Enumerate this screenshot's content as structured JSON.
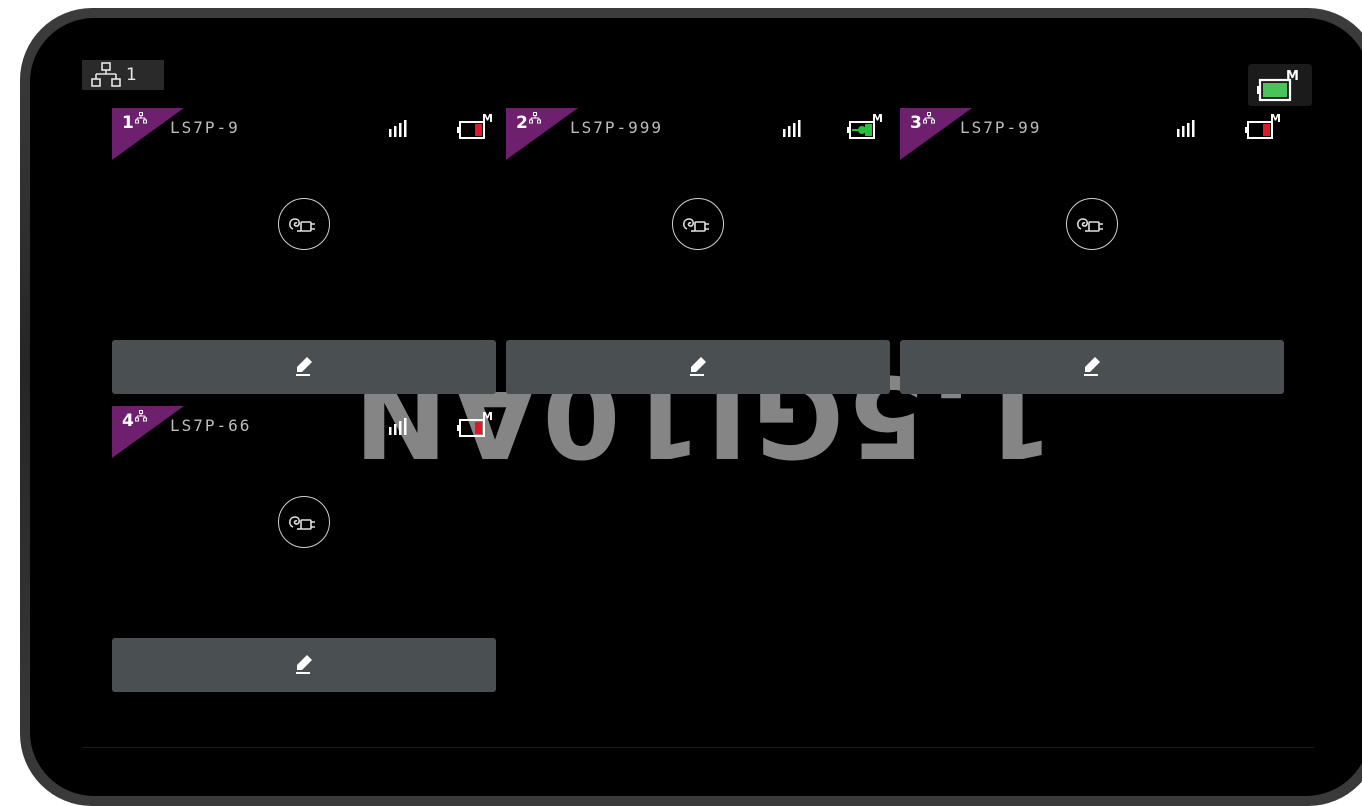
{
  "header": {
    "group_number": "1",
    "corner_dots": "..",
    "top_battery_mode": "M",
    "top_battery_color": "#4cc25a"
  },
  "watermark": {
    "text": "1.5GI10AN"
  },
  "cards": [
    {
      "index": "1",
      "name": "LS7P-9",
      "battery_mode": "M",
      "battery_color": "#e0192a",
      "plug_icon": "plug-icon",
      "edit_icon": "pencil-icon"
    },
    {
      "index": "2",
      "name": "LS7P-999",
      "battery_mode": "M",
      "battery_color": "#22c23a",
      "plug_icon": "plug-icon",
      "edit_icon": "pencil-icon"
    },
    {
      "index": "3",
      "name": "LS7P-99",
      "battery_mode": "M",
      "battery_color": "#e0192a",
      "plug_icon": "plug-icon",
      "edit_icon": "pencil-icon"
    },
    {
      "index": "4",
      "name": "LS7P-66",
      "battery_mode": "M",
      "battery_color": "#e0192a",
      "plug_icon": "plug-icon",
      "edit_icon": "pencil-icon"
    }
  ],
  "colors": {
    "accent_purple": "#6e1f6e",
    "edit_bar": "#4a4f51",
    "screen_bg": "#000000"
  }
}
